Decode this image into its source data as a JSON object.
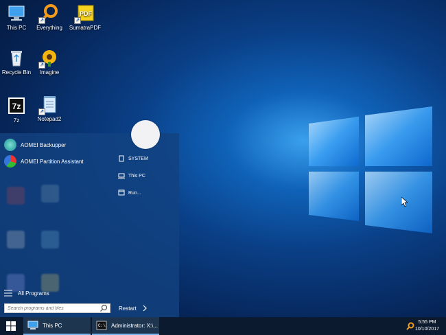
{
  "desktop": {
    "icons": [
      {
        "label": "This PC"
      },
      {
        "label": "Everything"
      },
      {
        "label": "SumatraPDF"
      },
      {
        "label": "Recycle Bin"
      },
      {
        "label": "Imagine"
      },
      {
        "label": "7z"
      },
      {
        "label": "Notepad2"
      }
    ]
  },
  "start_menu": {
    "programs": [
      {
        "label": "AOMEI Backupper"
      },
      {
        "label": "AOMEI Partition Assistant"
      }
    ],
    "all_programs_label": "All Programs",
    "search_placeholder": "Search programs and files",
    "right_items": [
      {
        "label": "SYSTEM",
        "icon": "document-icon"
      },
      {
        "label": "This PC",
        "icon": "computer-icon"
      },
      {
        "label": "Run...",
        "icon": "run-icon"
      }
    ],
    "restart_label": "Restart"
  },
  "taskbar": {
    "buttons": [
      {
        "label": "This PC"
      },
      {
        "label": "Administrator: X:\\..."
      }
    ],
    "clock": {
      "time": "5:55 PM",
      "date": "10/10/2017"
    }
  },
  "colors": {
    "accent": "#1a78d8",
    "taskbar": "#0b1a2e",
    "start_menu": "#124280"
  }
}
